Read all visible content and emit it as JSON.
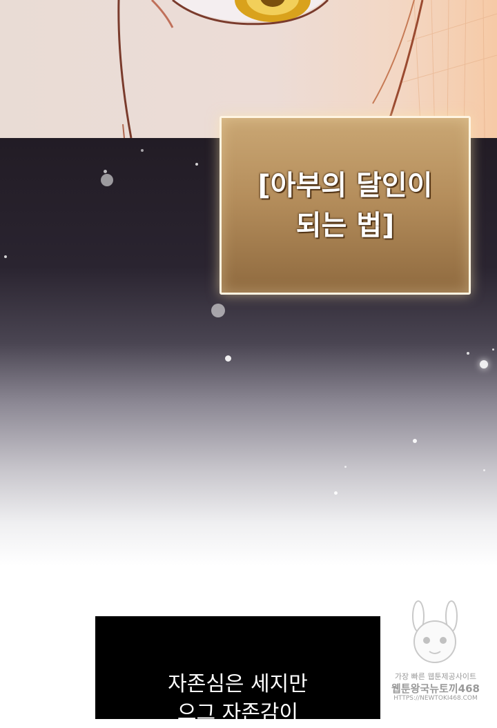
{
  "title_box": {
    "text": "[아부의 달인이\n되는 법]"
  },
  "caption": {
    "text": "자존심은 세지만\n으그 자존감이"
  },
  "watermark": {
    "line1": "가장 빠른 웹툰제공사이트",
    "line2": "웹툰왕국뉴토끼468",
    "line3": "HTTPS://NEWTOKI468.COM"
  },
  "colors": {
    "title_box_fill": "#b58e5c",
    "title_box_border": "#fff5e2",
    "caption_bg": "#000000",
    "eye_iris": "#d9a21c"
  }
}
